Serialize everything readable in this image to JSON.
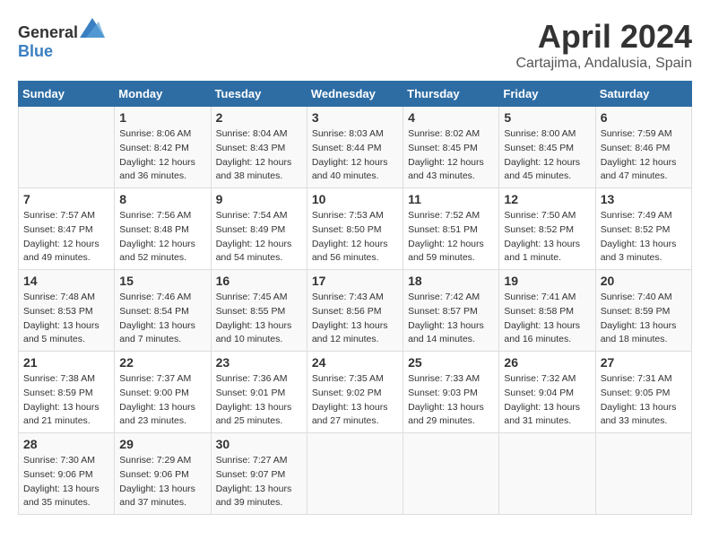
{
  "header": {
    "logo_general": "General",
    "logo_blue": "Blue",
    "month": "April 2024",
    "location": "Cartajima, Andalusia, Spain"
  },
  "days_of_week": [
    "Sunday",
    "Monday",
    "Tuesday",
    "Wednesday",
    "Thursday",
    "Friday",
    "Saturday"
  ],
  "weeks": [
    [
      {
        "day": "",
        "info": ""
      },
      {
        "day": "1",
        "info": "Sunrise: 8:06 AM\nSunset: 8:42 PM\nDaylight: 12 hours\nand 36 minutes."
      },
      {
        "day": "2",
        "info": "Sunrise: 8:04 AM\nSunset: 8:43 PM\nDaylight: 12 hours\nand 38 minutes."
      },
      {
        "day": "3",
        "info": "Sunrise: 8:03 AM\nSunset: 8:44 PM\nDaylight: 12 hours\nand 40 minutes."
      },
      {
        "day": "4",
        "info": "Sunrise: 8:02 AM\nSunset: 8:45 PM\nDaylight: 12 hours\nand 43 minutes."
      },
      {
        "day": "5",
        "info": "Sunrise: 8:00 AM\nSunset: 8:45 PM\nDaylight: 12 hours\nand 45 minutes."
      },
      {
        "day": "6",
        "info": "Sunrise: 7:59 AM\nSunset: 8:46 PM\nDaylight: 12 hours\nand 47 minutes."
      }
    ],
    [
      {
        "day": "7",
        "info": "Sunrise: 7:57 AM\nSunset: 8:47 PM\nDaylight: 12 hours\nand 49 minutes."
      },
      {
        "day": "8",
        "info": "Sunrise: 7:56 AM\nSunset: 8:48 PM\nDaylight: 12 hours\nand 52 minutes."
      },
      {
        "day": "9",
        "info": "Sunrise: 7:54 AM\nSunset: 8:49 PM\nDaylight: 12 hours\nand 54 minutes."
      },
      {
        "day": "10",
        "info": "Sunrise: 7:53 AM\nSunset: 8:50 PM\nDaylight: 12 hours\nand 56 minutes."
      },
      {
        "day": "11",
        "info": "Sunrise: 7:52 AM\nSunset: 8:51 PM\nDaylight: 12 hours\nand 59 minutes."
      },
      {
        "day": "12",
        "info": "Sunrise: 7:50 AM\nSunset: 8:52 PM\nDaylight: 13 hours\nand 1 minute."
      },
      {
        "day": "13",
        "info": "Sunrise: 7:49 AM\nSunset: 8:52 PM\nDaylight: 13 hours\nand 3 minutes."
      }
    ],
    [
      {
        "day": "14",
        "info": "Sunrise: 7:48 AM\nSunset: 8:53 PM\nDaylight: 13 hours\nand 5 minutes."
      },
      {
        "day": "15",
        "info": "Sunrise: 7:46 AM\nSunset: 8:54 PM\nDaylight: 13 hours\nand 7 minutes."
      },
      {
        "day": "16",
        "info": "Sunrise: 7:45 AM\nSunset: 8:55 PM\nDaylight: 13 hours\nand 10 minutes."
      },
      {
        "day": "17",
        "info": "Sunrise: 7:43 AM\nSunset: 8:56 PM\nDaylight: 13 hours\nand 12 minutes."
      },
      {
        "day": "18",
        "info": "Sunrise: 7:42 AM\nSunset: 8:57 PM\nDaylight: 13 hours\nand 14 minutes."
      },
      {
        "day": "19",
        "info": "Sunrise: 7:41 AM\nSunset: 8:58 PM\nDaylight: 13 hours\nand 16 minutes."
      },
      {
        "day": "20",
        "info": "Sunrise: 7:40 AM\nSunset: 8:59 PM\nDaylight: 13 hours\nand 18 minutes."
      }
    ],
    [
      {
        "day": "21",
        "info": "Sunrise: 7:38 AM\nSunset: 8:59 PM\nDaylight: 13 hours\nand 21 minutes."
      },
      {
        "day": "22",
        "info": "Sunrise: 7:37 AM\nSunset: 9:00 PM\nDaylight: 13 hours\nand 23 minutes."
      },
      {
        "day": "23",
        "info": "Sunrise: 7:36 AM\nSunset: 9:01 PM\nDaylight: 13 hours\nand 25 minutes."
      },
      {
        "day": "24",
        "info": "Sunrise: 7:35 AM\nSunset: 9:02 PM\nDaylight: 13 hours\nand 27 minutes."
      },
      {
        "day": "25",
        "info": "Sunrise: 7:33 AM\nSunset: 9:03 PM\nDaylight: 13 hours\nand 29 minutes."
      },
      {
        "day": "26",
        "info": "Sunrise: 7:32 AM\nSunset: 9:04 PM\nDaylight: 13 hours\nand 31 minutes."
      },
      {
        "day": "27",
        "info": "Sunrise: 7:31 AM\nSunset: 9:05 PM\nDaylight: 13 hours\nand 33 minutes."
      }
    ],
    [
      {
        "day": "28",
        "info": "Sunrise: 7:30 AM\nSunset: 9:06 PM\nDaylight: 13 hours\nand 35 minutes."
      },
      {
        "day": "29",
        "info": "Sunrise: 7:29 AM\nSunset: 9:06 PM\nDaylight: 13 hours\nand 37 minutes."
      },
      {
        "day": "30",
        "info": "Sunrise: 7:27 AM\nSunset: 9:07 PM\nDaylight: 13 hours\nand 39 minutes."
      },
      {
        "day": "",
        "info": ""
      },
      {
        "day": "",
        "info": ""
      },
      {
        "day": "",
        "info": ""
      },
      {
        "day": "",
        "info": ""
      }
    ]
  ]
}
